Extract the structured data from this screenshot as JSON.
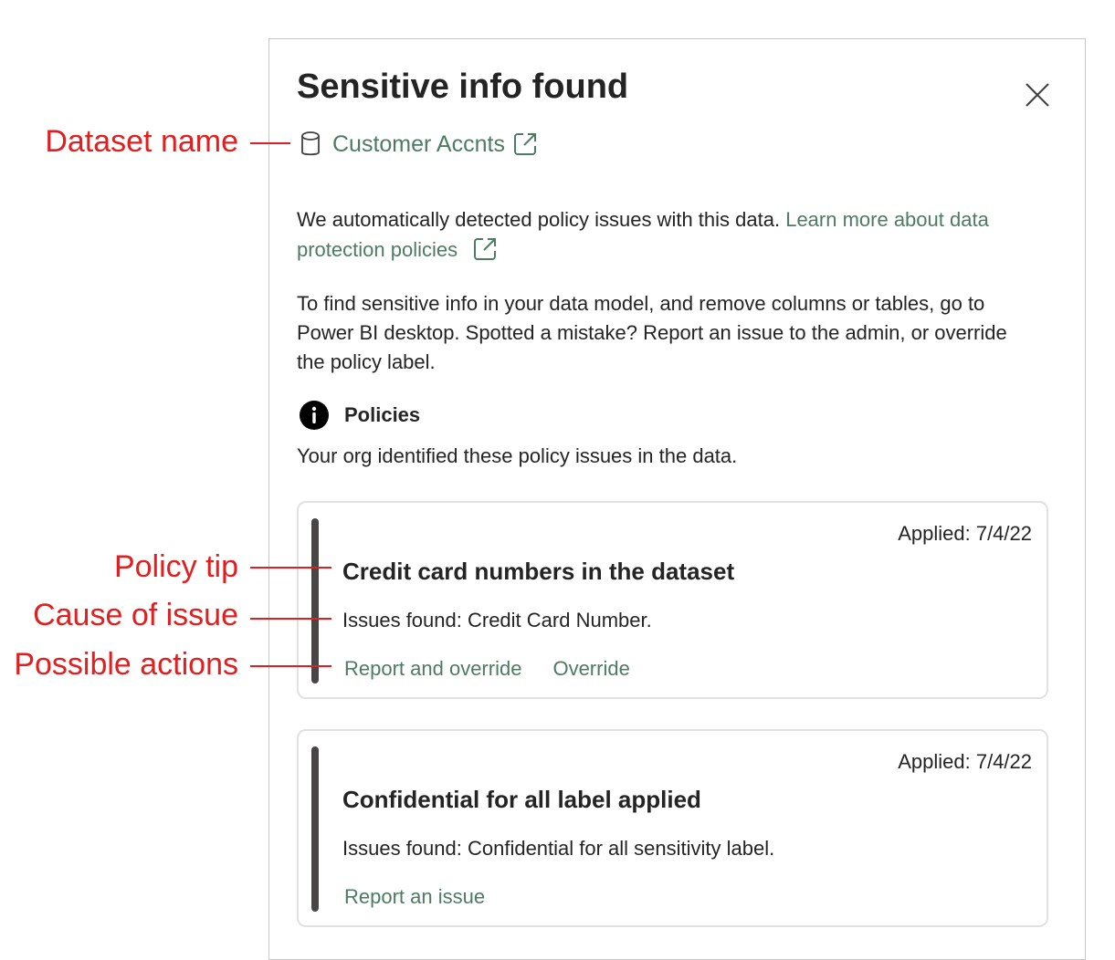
{
  "panel": {
    "title": "Sensitive info found",
    "dataset_name": "Customer Accnts",
    "intro_text": "We automatically detected policy issues with this data.",
    "learn_more_link": "Learn more about data protection policies",
    "instructions": "To find sensitive info in your data model, and remove columns or tables, go to Power BI desktop. Spotted a mistake? Report an issue to the admin, or override the policy label.",
    "policies_label": "Policies",
    "policies_description": "Your org identified these policy issues in the data.",
    "cards": [
      {
        "applied": "Applied: 7/4/22",
        "title": "Credit card numbers in the dataset",
        "issues": "Issues found: Credit Card Number.",
        "actions": [
          "Report and override",
          "Override"
        ]
      },
      {
        "applied": "Applied: 7/4/22",
        "title": "Confidential for all label applied",
        "issues": "Issues found: Confidential for all sensitivity label.",
        "actions": [
          "Report an issue"
        ]
      }
    ]
  },
  "annotations": {
    "dataset_name": "Dataset name",
    "policy_tip": "Policy tip",
    "cause_of_issue": "Cause of issue",
    "possible_actions": "Possible actions"
  },
  "colors": {
    "link": "#4d7b63",
    "annotation": "#e02020",
    "card_bar": "#484644",
    "text": "#242424"
  },
  "icons": [
    "close-icon",
    "database-icon",
    "external-link-icon",
    "info-icon"
  ]
}
